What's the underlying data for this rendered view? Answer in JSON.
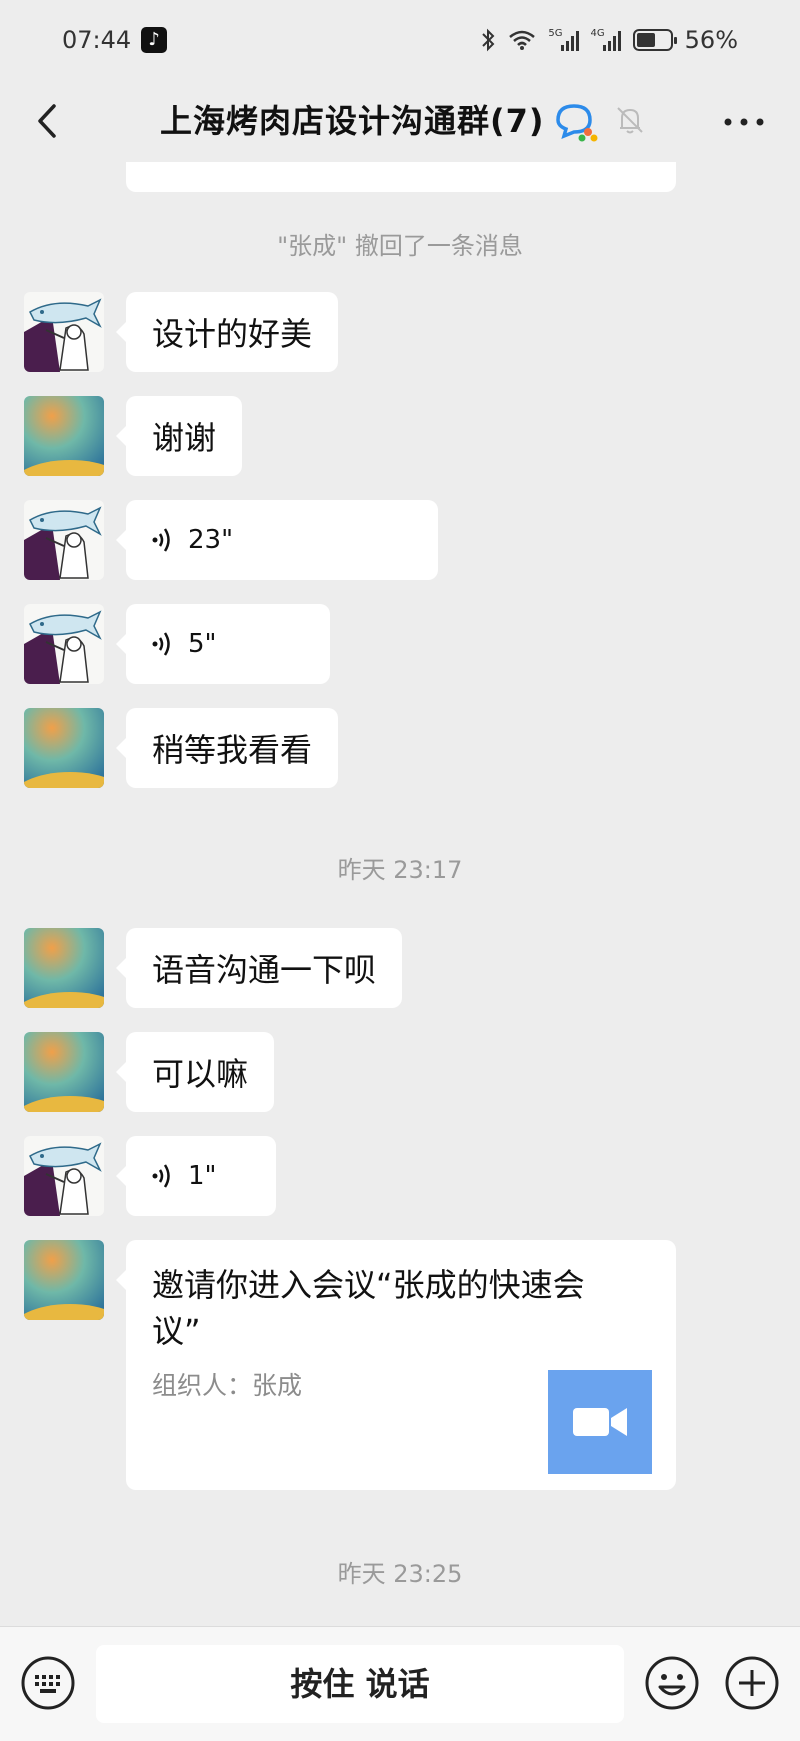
{
  "status_bar": {
    "time": "07:44",
    "tiktok_badge": "♪",
    "net_tag_1": "5G",
    "net_tag_2": "4G",
    "battery_text": "56%",
    "battery_level": 0.56
  },
  "header": {
    "title": "上海烤肉店设计沟通群(7)"
  },
  "chat": {
    "recall_notice": "\"张成\" 撤回了一条消息",
    "timestamps": [
      "昨天 23:17",
      "昨天 23:25"
    ],
    "messages": [
      {
        "type": "text",
        "avatar": "illustration",
        "text": "设计的好美"
      },
      {
        "type": "text",
        "avatar": "gradient",
        "text": "谢谢"
      },
      {
        "type": "voice",
        "avatar": "illustration",
        "duration": "23\""
      },
      {
        "type": "voice",
        "avatar": "illustration",
        "duration": "5\""
      },
      {
        "type": "text",
        "avatar": "gradient",
        "text": "稍等我看看"
      },
      {
        "type": "text",
        "avatar": "gradient",
        "text": "语音沟通一下呗"
      },
      {
        "type": "text",
        "avatar": "gradient",
        "text": "可以嘛"
      },
      {
        "type": "voice",
        "avatar": "illustration",
        "duration": "1\""
      },
      {
        "type": "meeting_card",
        "avatar": "gradient",
        "title": "邀请你进入会议“张成的快速会议”",
        "organizer": "组织人：张成"
      }
    ]
  },
  "input_bar": {
    "talk_label": "按住 说话"
  },
  "colors": {
    "background": "#ededed",
    "bubble": "#ffffff",
    "meeting_thumb": "#6aa3ee",
    "system_text": "#9a9a9a"
  },
  "icons": [
    "back-icon",
    "group-chat-icon",
    "mute-bell-icon",
    "more-icon",
    "voice-wave-icon",
    "video-camera-icon",
    "keyboard-icon",
    "emoji-icon",
    "plus-icon"
  ]
}
